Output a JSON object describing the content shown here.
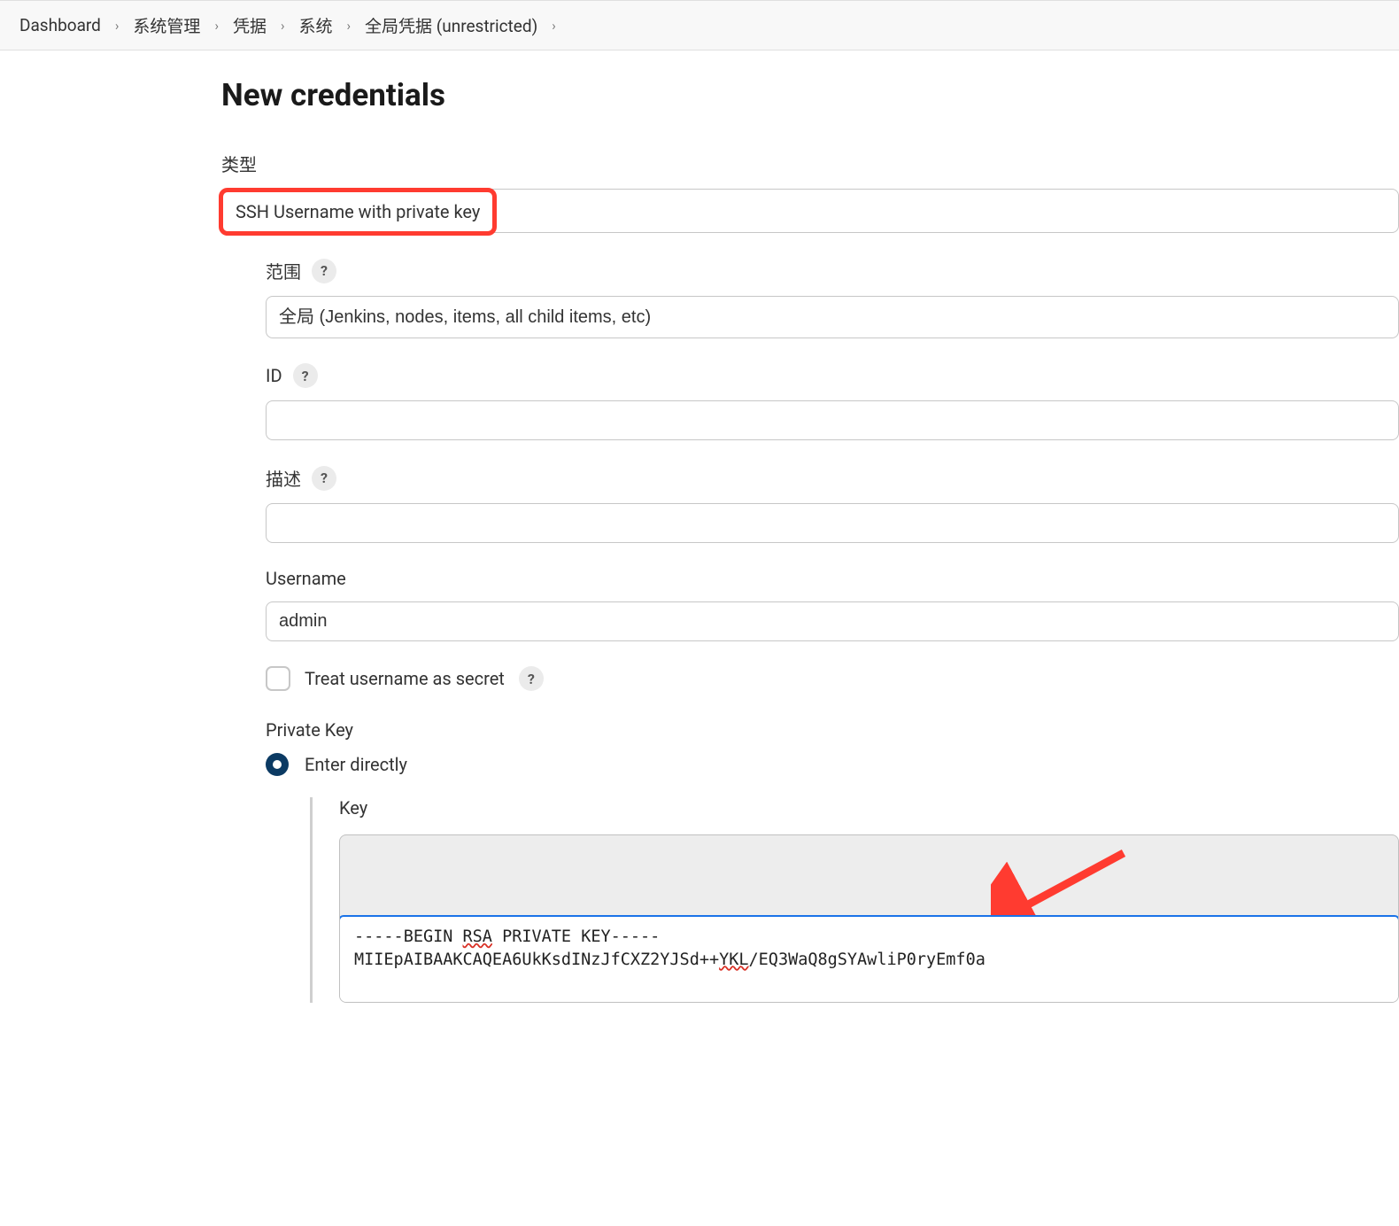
{
  "breadcrumb": {
    "items": [
      "Dashboard",
      "系统管理",
      "凭据",
      "系统",
      "全局凭据 (unrestricted)"
    ]
  },
  "page": {
    "title": "New credentials"
  },
  "form": {
    "type_label": "类型",
    "type_value": "SSH Username with private key",
    "scope_label": "范围",
    "scope_value": "全局 (Jenkins, nodes, items, all child items, etc)",
    "id_label": "ID",
    "id_value": "",
    "description_label": "描述",
    "description_value": "",
    "username_label": "Username",
    "username_value": "admin",
    "treat_secret_label": "Treat username as secret",
    "treat_secret_checked": false,
    "private_key_label": "Private Key",
    "enter_directly_label": "Enter directly",
    "enter_directly_selected": true,
    "key_label": "Key",
    "key_value": "-----BEGIN RSA PRIVATE KEY-----\nMIIEpAIBAAKCAQEA6UkKsdINzJfCXZ2YJSd++YKL/EQ3WaQ8gSYAwliP0ryEmf0a"
  },
  "icons": {
    "help": "?",
    "chevron": "›"
  }
}
